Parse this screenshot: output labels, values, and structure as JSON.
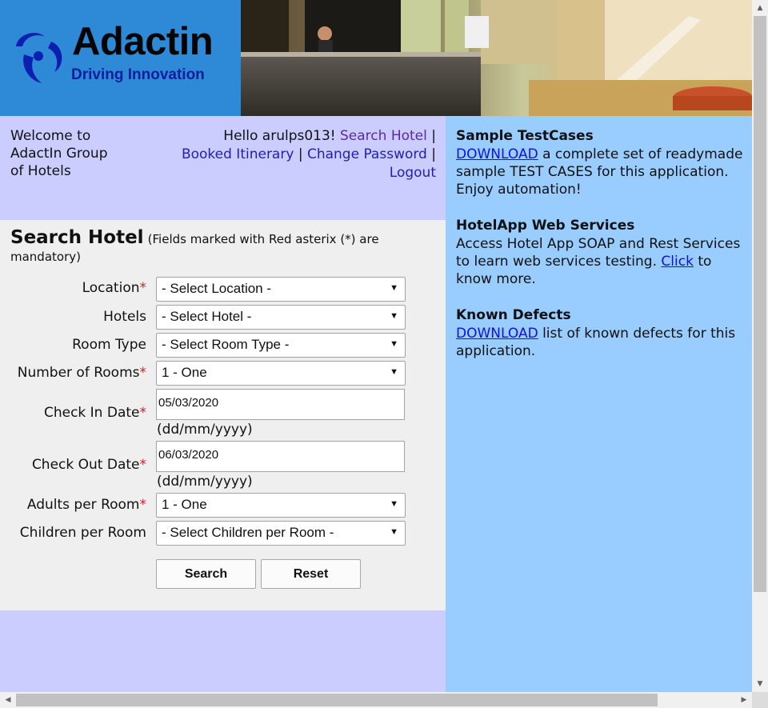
{
  "brand": {
    "name": "Adactin",
    "tagline": "Driving Innovation",
    "logo_color": "#2e8ad6"
  },
  "welcome": {
    "line1": "Welcome to",
    "line2": "AdactIn Group",
    "line3": "of Hotels"
  },
  "user_nav": {
    "greeting": "Hello arulps013!",
    "search_hotel": "Search Hotel",
    "booked_itinerary": "Booked Itinerary",
    "change_password": "Change Password",
    "logout": "Logout",
    "separator": "|"
  },
  "search_form": {
    "title": "Search Hotel",
    "note": "(Fields marked with Red asterix (*) are mandatory)",
    "required_mark": "*",
    "fields": {
      "location": {
        "label": "Location",
        "value": "- Select Location -"
      },
      "hotels": {
        "label": "Hotels",
        "value": "- Select Hotel -"
      },
      "room_type": {
        "label": "Room Type",
        "value": "- Select Room Type -"
      },
      "number_of_rooms": {
        "label": "Number of Rooms",
        "value": "1 - One"
      },
      "check_in": {
        "label": "Check In Date",
        "value": "05/03/2020",
        "hint": "(dd/mm/yyyy)"
      },
      "check_out": {
        "label": "Check Out Date",
        "value": "06/03/2020",
        "hint": "(dd/mm/yyyy)"
      },
      "adults": {
        "label": "Adults per Room",
        "value": "1 - One"
      },
      "children": {
        "label": "Children per Room",
        "value": "- Select Children per Room -"
      }
    },
    "search_label": "Search",
    "reset_label": "Reset"
  },
  "sidebar": {
    "testcases": {
      "heading": "Sample TestCases",
      "link": "DOWNLOAD",
      "text": " a complete set of readymade sample TEST CASES for this application. Enjoy automation!"
    },
    "webservices": {
      "heading": "HotelApp Web Services",
      "text": "Access Hotel App SOAP and Rest Services to learn web services testing. ",
      "link": "Click",
      "text2": " to know more."
    },
    "defects": {
      "heading": "Known Defects",
      "link": "DOWNLOAD",
      "text": " list of known defects for this application."
    }
  },
  "colors": {
    "band_lavender": "#cccdff",
    "form_bg": "#efefef",
    "sidebar_bg": "#99ccff",
    "required": "#d42020",
    "link": "#1010e0",
    "nav_link": "#2020b8"
  }
}
